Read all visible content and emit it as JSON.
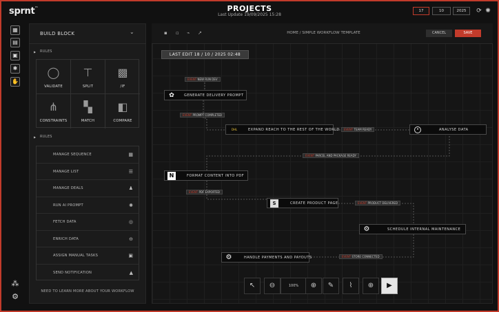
{
  "header": {
    "logo": "sprnt",
    "logo_mark": "™",
    "title": "PROJECTS",
    "subtitle": "Last Update 19/09/2025  15:28",
    "date_boxes": [
      "17",
      "10",
      "2025"
    ]
  },
  "rail": {
    "icons": [
      "dashboard-icon",
      "calendar-icon",
      "notes-icon",
      "settings-icon",
      "hand-icon"
    ],
    "bottom_icons": [
      "share-icon",
      "gear-icon"
    ]
  },
  "build_block": {
    "title": "BUILD BLOCK",
    "rules_label_1": "RULES",
    "rules_label_2": "RULES",
    "grid": [
      {
        "label": "VALIDATE",
        "icon": "circle-icon"
      },
      {
        "label": "SPLIT",
        "icon": "split-icon"
      },
      {
        "label": "/IF",
        "icon": "chip-icon"
      },
      {
        "label": "CONSTRAINTS",
        "icon": "constraints-icon"
      },
      {
        "label": "MATCH",
        "icon": "match-icon"
      },
      {
        "label": "COMPARE",
        "icon": "compare-icon"
      }
    ],
    "list": [
      {
        "label": "MANAGE SEQUENCE",
        "icon": "grid-icon"
      },
      {
        "label": "MANAGE LIST",
        "icon": "list-icon"
      },
      {
        "label": "MANAGE DEALS",
        "icon": "deals-icon"
      },
      {
        "label": "RUN AI PROMPT",
        "icon": "ai-icon"
      },
      {
        "label": "FETCH DATA",
        "icon": "database-icon"
      },
      {
        "label": "ENRICH DATA",
        "icon": "enrich-icon"
      },
      {
        "label": "ASSIGN MANUAL TASKS",
        "icon": "task-icon"
      },
      {
        "label": "SEND NOTIFICATION",
        "icon": "bell-icon"
      }
    ],
    "learn_more": "NEED TO LEARN MORE ABOUT YOUR WORKFLOW"
  },
  "canvas": {
    "breadcrumb": "HOME / SIMPLE WORKFLOW TEMPLATE",
    "cancel_label": "CANCEL",
    "save_label": "SAVE",
    "last_edit": "LAST EDIT 18 / 10 / 2025  02:48",
    "nodes": [
      {
        "label": "GENERATE DELIVERY PROMPT",
        "icon": "openai-icon"
      },
      {
        "label": "EXPAND REACH TO THE REST OF THE WORLD",
        "icon": "dhl-icon",
        "icon_text": "DHL"
      },
      {
        "label": "ANALYSE DATA",
        "icon": "analyse-icon"
      },
      {
        "label": "FORMAT CONTENT INTO PDF",
        "icon": "notion-icon",
        "icon_text": "N"
      },
      {
        "label": "CREATE PRODUCT PAGE",
        "icon": "shopify-icon",
        "icon_text": "S"
      },
      {
        "label": "SCHEDULE INTERNAL MAINTENANCE",
        "icon": "gear-icon"
      },
      {
        "label": "HANDLE PAYMENTS AND PAYOUTS",
        "icon": "gear-icon"
      }
    ],
    "badges": [
      {
        "key": "EVENT",
        "text": "NEW RUN DEV"
      },
      {
        "key": "EVENT",
        "text": "PROMPT COMPLETED"
      },
      {
        "key": "EVENT",
        "text": "TEAM READY"
      },
      {
        "key": "EVENT",
        "text": "PARCEL AND PACKAGE READY"
      },
      {
        "key": "EVENT",
        "text": "PDF EXPORTED"
      },
      {
        "key": "EVENT",
        "text": "PRODUCT DELIVERED"
      },
      {
        "key": "EVENT",
        "text": "STORE CONNECTED"
      }
    ],
    "zoom": "100%",
    "tools": [
      "pointer-icon",
      "zoom-out-icon",
      "zoom-in-icon",
      "pen-icon",
      "attach-icon",
      "globe-icon",
      "play-icon"
    ]
  },
  "colors": {
    "accent": "#c23b2b",
    "bg": "#111111",
    "panel": "#1b1b1b"
  }
}
